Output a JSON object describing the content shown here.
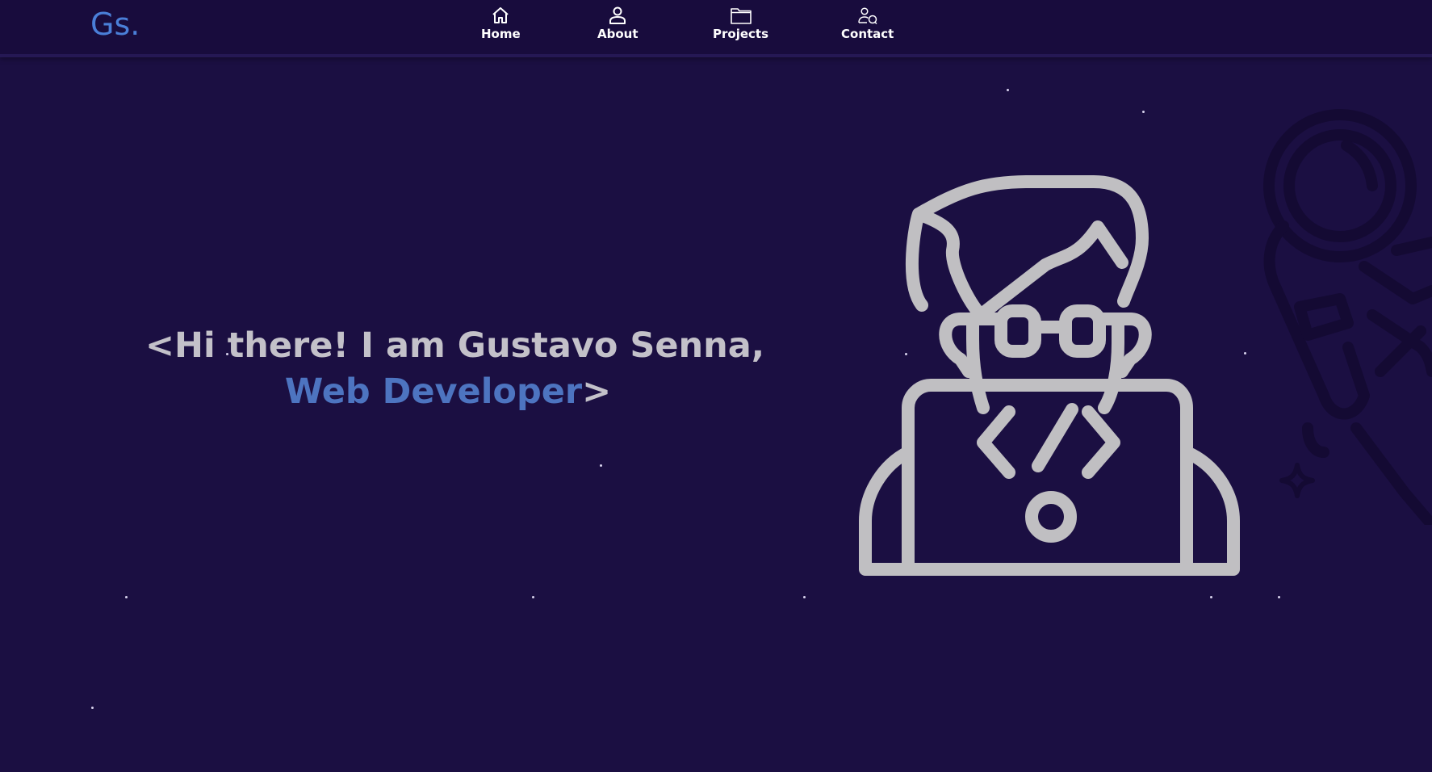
{
  "nav": {
    "logo": "Gs.",
    "items": [
      {
        "label": "Home",
        "icon": "home-icon"
      },
      {
        "label": "About",
        "icon": "user-icon"
      },
      {
        "label": "Projects",
        "icon": "folder-icon"
      },
      {
        "label": "Contact",
        "icon": "contact-icon"
      }
    ]
  },
  "hero": {
    "line1": "<Hi there! I am Gustavo Senna,",
    "role": "Web Developer",
    "closing": ">"
  },
  "colors": {
    "background": "#1b0f42",
    "navbar": "#180c3d",
    "accent": "#4a7fd8",
    "text": "#c3c1c9",
    "illustration": "#c0bfc2"
  },
  "illustration": {
    "icon": "developer-icon",
    "decor": [
      "astronaut-icon",
      "sparkle-icon",
      "star-icon"
    ]
  }
}
